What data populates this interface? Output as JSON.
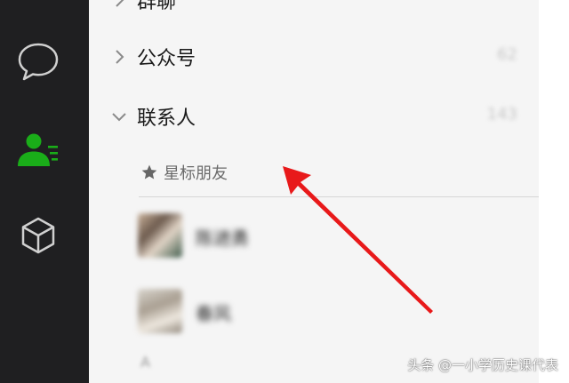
{
  "sidebar": {
    "items": [
      {
        "name": "chat",
        "icon": "chat-bubble-icon",
        "active": false
      },
      {
        "name": "contacts",
        "icon": "contacts-icon",
        "active": true
      },
      {
        "name": "discover",
        "icon": "cube-icon",
        "active": false
      }
    ],
    "active_color": "#1aad19"
  },
  "groups": [
    {
      "label": "群聊",
      "count": "",
      "expanded": false
    },
    {
      "label": "公众号",
      "count": "62",
      "expanded": false
    },
    {
      "label": "联系人",
      "count": "143",
      "expanded": true
    }
  ],
  "starred_section": {
    "label": "星标朋友",
    "icon": "star-icon"
  },
  "contacts": [
    {
      "name": "陈进勇"
    },
    {
      "name": "春风"
    }
  ],
  "index_letter": "A",
  "annotation": {
    "type": "red-arrow",
    "color": "#e8191a"
  },
  "watermark": "头条 @一小学历史课代表"
}
